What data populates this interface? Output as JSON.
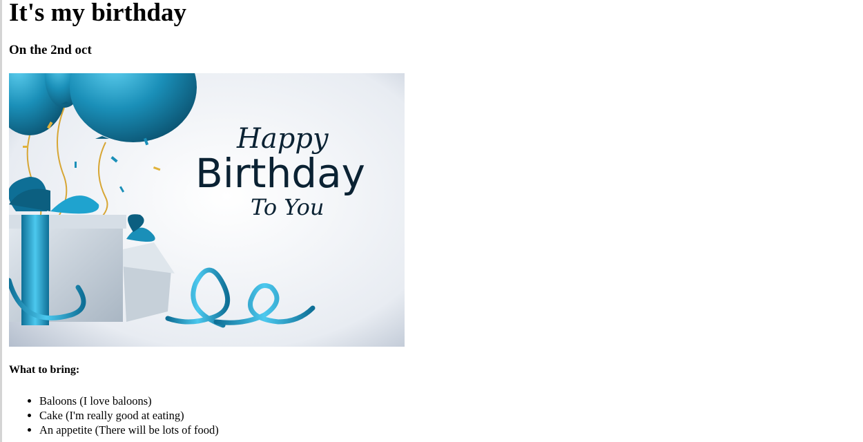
{
  "heading": "It's my birthday",
  "subheading": "On the 2nd oct",
  "banner": {
    "line1": "Happy",
    "line2": "Birthday",
    "line3": "To You",
    "colors": {
      "balloon": "#1a8fb8",
      "balloon_dark": "#0c5f80",
      "ribbon": "#1fa3cf",
      "box": "#c9d3dc",
      "text": "#0b2233",
      "background": "#f2f4f7",
      "confetti": "#e0b23a"
    }
  },
  "bring_title": "What to bring:",
  "bring_items": [
    {
      "text": "Baloons (I love baloons)"
    },
    {
      "text": "Cake (I'm really good at eating)"
    },
    {
      "text": "An appetite (There will be lots of food)"
    }
  ]
}
